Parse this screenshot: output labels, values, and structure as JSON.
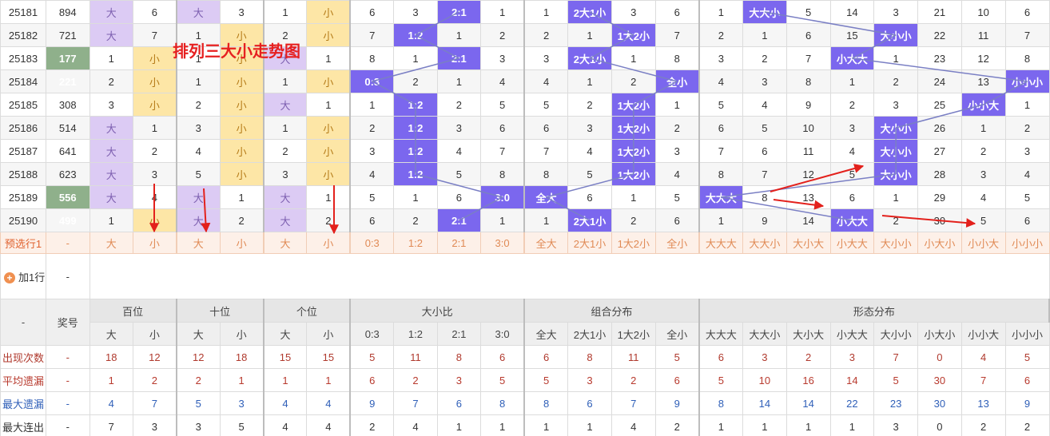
{
  "title_text": "排列三大小走势图",
  "columns": [
    "大",
    "小",
    "大",
    "小",
    "大",
    "小",
    "0:3",
    "1:2",
    "2:1",
    "3:0",
    "全大",
    "2大1小",
    "1大2小",
    "全小",
    "大大大",
    "大大小",
    "大小大",
    "小大大",
    "大小小",
    "小大小",
    "小小大",
    "小小小"
  ],
  "rows": [
    {
      "issue": "25181",
      "num": "894",
      "cells": [
        "大",
        "6",
        "大",
        "3",
        "1",
        "小",
        "6",
        "3",
        "2:1",
        "1",
        "1",
        "2大1小",
        "3",
        "6",
        "1",
        "大大小",
        "5",
        "14",
        "3",
        "21",
        "10",
        "6"
      ],
      "hl": [
        0,
        2,
        5,
        8,
        11,
        15
      ]
    },
    {
      "issue": "25182",
      "num": "721",
      "cells": [
        "大",
        "7",
        "1",
        "小",
        "2",
        "小",
        "7",
        "1:2",
        "1",
        "2",
        "2",
        "1",
        "1大2小",
        "7",
        "2",
        "1",
        "6",
        "15",
        "大小小",
        "22",
        "11",
        "7"
      ],
      "hl": [
        0,
        3,
        5,
        7,
        12,
        18
      ]
    },
    {
      "issue": "25183",
      "num": "177",
      "cells": [
        "1",
        "小",
        "1",
        "小",
        "大",
        "1",
        "8",
        "1",
        "2:1",
        "3",
        "3",
        "2大1小",
        "1",
        "8",
        "3",
        "2",
        "7",
        "小大大",
        "1",
        "23",
        "12",
        "8"
      ],
      "hl": [
        1,
        3,
        4,
        8,
        11,
        17
      ]
    },
    {
      "issue": "25184",
      "num": "221",
      "cells": [
        "2",
        "小",
        "1",
        "小",
        "1",
        "小",
        "0:3",
        "2",
        "1",
        "4",
        "4",
        "1",
        "2",
        "全小",
        "4",
        "3",
        "8",
        "1",
        "2",
        "24",
        "13",
        "小小小"
      ],
      "hl": [
        1,
        3,
        5,
        6,
        13,
        21
      ]
    },
    {
      "issue": "25185",
      "num": "308",
      "cells": [
        "3",
        "小",
        "2",
        "小",
        "大",
        "1",
        "1",
        "1:2",
        "2",
        "5",
        "5",
        "2",
        "1大2小",
        "1",
        "5",
        "4",
        "9",
        "2",
        "3",
        "25",
        "小小大",
        "1"
      ],
      "hl": [
        1,
        3,
        4,
        7,
        12,
        20
      ]
    },
    {
      "issue": "25186",
      "num": "514",
      "cells": [
        "大",
        "1",
        "3",
        "小",
        "1",
        "小",
        "2",
        "1:2",
        "3",
        "6",
        "6",
        "3",
        "1大2小",
        "2",
        "6",
        "5",
        "10",
        "3",
        "大小小",
        "26",
        "1",
        "2"
      ],
      "hl": [
        0,
        3,
        5,
        7,
        12,
        18
      ]
    },
    {
      "issue": "25187",
      "num": "641",
      "cells": [
        "大",
        "2",
        "4",
        "小",
        "2",
        "小",
        "3",
        "1:2",
        "4",
        "7",
        "7",
        "4",
        "1大2小",
        "3",
        "7",
        "6",
        "11",
        "4",
        "大小小",
        "27",
        "2",
        "3"
      ],
      "hl": [
        0,
        3,
        5,
        7,
        12,
        18
      ]
    },
    {
      "issue": "25188",
      "num": "623",
      "cells": [
        "大",
        "3",
        "5",
        "小",
        "3",
        "小",
        "4",
        "1:2",
        "5",
        "8",
        "8",
        "5",
        "1大2小",
        "4",
        "8",
        "7",
        "12",
        "5",
        "大小小",
        "28",
        "3",
        "4"
      ],
      "hl": [
        0,
        3,
        5,
        7,
        12,
        18
      ]
    },
    {
      "issue": "25189",
      "num": "556",
      "cells": [
        "大",
        "4",
        "大",
        "1",
        "大",
        "1",
        "5",
        "1",
        "6",
        "3:0",
        "全大",
        "6",
        "1",
        "5",
        "大大大",
        "8",
        "13",
        "6",
        "1",
        "29",
        "4",
        "5"
      ],
      "hl": [
        0,
        2,
        4,
        9,
        10,
        14
      ]
    },
    {
      "issue": "25190",
      "num": "499",
      "cells": [
        "1",
        "小",
        "大",
        "2",
        "大",
        "2",
        "6",
        "2",
        "2:1",
        "1",
        "1",
        "2大1小",
        "2",
        "6",
        "1",
        "9",
        "14",
        "小大大",
        "2",
        "30",
        "5",
        "6"
      ],
      "hl": [
        1,
        2,
        4,
        8,
        11,
        17
      ]
    }
  ],
  "predict_row": {
    "label": "预选行1",
    "num": "-",
    "cells": [
      "大",
      "小",
      "大",
      "小",
      "大",
      "小",
      "0:3",
      "1:2",
      "2:1",
      "3:0",
      "全大",
      "2大1小",
      "1大2小",
      "全小",
      "大大大",
      "大大小",
      "大小大",
      "小大大",
      "大小小",
      "小大小",
      "小小大",
      "小小小"
    ]
  },
  "add_row": {
    "label": "加1行",
    "num": "-"
  },
  "header": {
    "corner": "-",
    "award": "奖号",
    "groups": [
      "百位",
      "十位",
      "个位",
      "大小比",
      "组合分布",
      "形态分布"
    ]
  },
  "stats": [
    {
      "label": "出现次数",
      "num": "-",
      "values": [
        "18",
        "12",
        "12",
        "18",
        "15",
        "15",
        "5",
        "11",
        "8",
        "6",
        "6",
        "8",
        "11",
        "5",
        "6",
        "3",
        "2",
        "3",
        "7",
        "0",
        "4",
        "5"
      ]
    },
    {
      "label": "平均遗漏",
      "num": "-",
      "values": [
        "1",
        "2",
        "2",
        "1",
        "1",
        "1",
        "6",
        "2",
        "3",
        "5",
        "5",
        "3",
        "2",
        "6",
        "5",
        "10",
        "16",
        "14",
        "5",
        "30",
        "7",
        "6"
      ]
    },
    {
      "label": "最大遗漏",
      "num": "-",
      "values": [
        "4",
        "7",
        "5",
        "3",
        "4",
        "4",
        "9",
        "7",
        "6",
        "8",
        "8",
        "6",
        "7",
        "9",
        "8",
        "14",
        "14",
        "22",
        "23",
        "30",
        "13",
        "9"
      ]
    },
    {
      "label": "最大连出",
      "num": "-",
      "values": [
        "7",
        "3",
        "3",
        "5",
        "4",
        "4",
        "2",
        "4",
        "1",
        "1",
        "1",
        "1",
        "4",
        "2",
        "1",
        "1",
        "1",
        "1",
        "3",
        "0",
        "2",
        "2"
      ]
    }
  ],
  "colors": {
    "purple": "#7b67ee",
    "lightPurple": "#dccbf4",
    "yellow": "#fde6a6",
    "green": "#8fb08b",
    "arrow": "#e3211c",
    "trend": "#7a7fc4"
  }
}
